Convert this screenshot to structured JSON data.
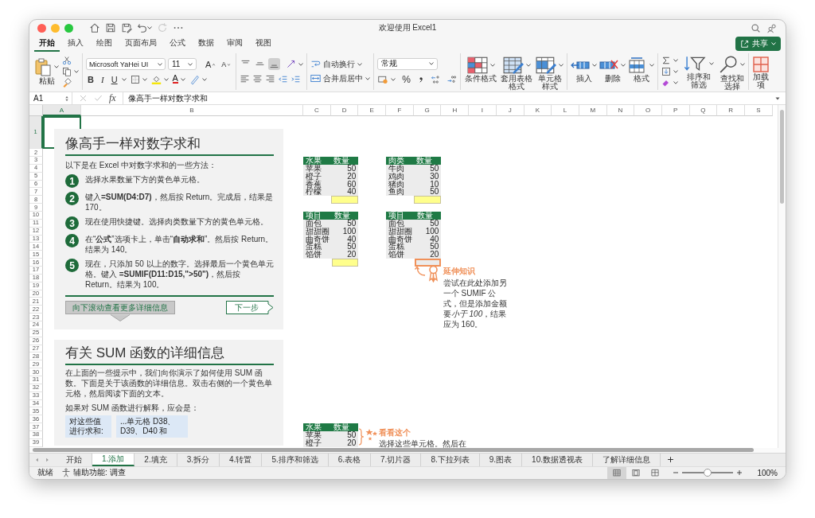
{
  "window": {
    "title": "欢迎使用 Excel1"
  },
  "quick_access": [
    {
      "kind": "home",
      "disabled": false
    },
    {
      "kind": "save",
      "disabled": false
    },
    {
      "kind": "save_as",
      "disabled": false
    },
    {
      "kind": "undo",
      "disabled": false
    },
    {
      "kind": "redo",
      "disabled": true
    },
    {
      "kind": "more",
      "disabled": false
    }
  ],
  "ribbon_tabs": [
    {
      "label": "开始",
      "selected": true
    },
    {
      "label": "插入",
      "selected": false
    },
    {
      "label": "绘图",
      "selected": false
    },
    {
      "label": "页面布局",
      "selected": false
    },
    {
      "label": "公式",
      "selected": false
    },
    {
      "label": "数据",
      "selected": false
    },
    {
      "label": "审阅",
      "selected": false
    },
    {
      "label": "视图",
      "selected": false
    }
  ],
  "share_button": {
    "label": "共享"
  },
  "ribbon": {
    "paste": {
      "label": "粘贴"
    },
    "font": {
      "name": "Microsoft YaHei UI",
      "size": "11",
      "grow": "A",
      "shrink": "A",
      "bold": "B",
      "italic": "I",
      "underline": "U",
      "color_letter": "A"
    },
    "vertical_align": [
      {
        "kind": "top",
        "selected": false
      },
      {
        "kind": "middle",
        "selected": false
      },
      {
        "kind": "bottom",
        "selected": true
      }
    ],
    "wrap_text": "自动换行",
    "merge_center": "合并后居中",
    "number_format": "常规",
    "percent": "%",
    "styles": [
      {
        "kind": "conditional",
        "label": "条件格式"
      },
      {
        "kind": "table",
        "label": "套用表格格式"
      },
      {
        "kind": "cell_styles",
        "label": "单元格样式"
      }
    ],
    "cells": [
      {
        "kind": "insert",
        "label": "插入"
      },
      {
        "kind": "delete",
        "label": "删除"
      },
      {
        "kind": "format",
        "label": "格式"
      }
    ],
    "editing": [
      {
        "kind": "sort",
        "label": "排序和筛选"
      },
      {
        "kind": "find",
        "label": "查找和选择"
      }
    ],
    "addins": {
      "label": "加载项"
    }
  },
  "formula_bar": {
    "name_box": "A1",
    "fx": "fx",
    "value": "像高手一样对数字求和"
  },
  "sheet": {
    "columns": [
      {
        "label": "A",
        "selected": true
      },
      {
        "label": "B",
        "selected": false
      },
      {
        "label": "C",
        "selected": false
      },
      {
        "label": "D",
        "selected": false
      },
      {
        "label": "E",
        "selected": false
      },
      {
        "label": "F",
        "selected": false
      },
      {
        "label": "G",
        "selected": false
      },
      {
        "label": "H",
        "selected": false
      },
      {
        "label": "I",
        "selected": false
      },
      {
        "label": "J",
        "selected": false
      },
      {
        "label": "K",
        "selected": false
      },
      {
        "label": "L",
        "selected": false
      },
      {
        "label": "M",
        "selected": false
      },
      {
        "label": "N",
        "selected": false
      },
      {
        "label": "O",
        "selected": false
      },
      {
        "label": "P",
        "selected": false
      },
      {
        "label": "Q",
        "selected": false
      },
      {
        "label": "R",
        "selected": false
      },
      {
        "label": "S",
        "selected": false
      }
    ],
    "rows": [
      {
        "label": "1",
        "selected": true
      },
      {
        "label": "2",
        "selected": false
      },
      {
        "label": "3",
        "selected": false
      },
      {
        "label": "4",
        "selected": false
      },
      {
        "label": "5",
        "selected": false
      },
      {
        "label": "6",
        "selected": false
      },
      {
        "label": "7",
        "selected": false
      },
      {
        "label": "8",
        "selected": false
      },
      {
        "label": "9",
        "selected": false
      },
      {
        "label": "10",
        "selected": false
      },
      {
        "label": "11",
        "selected": false
      },
      {
        "label": "12",
        "selected": false
      },
      {
        "label": "13",
        "selected": false
      },
      {
        "label": "14",
        "selected": false
      },
      {
        "label": "15",
        "selected": false
      },
      {
        "label": "16",
        "selected": false
      },
      {
        "label": "17",
        "selected": false
      },
      {
        "label": "18",
        "selected": false
      },
      {
        "label": "19",
        "selected": false
      },
      {
        "label": "20",
        "selected": false
      },
      {
        "label": "21",
        "selected": false
      },
      {
        "label": "22",
        "selected": false
      },
      {
        "label": "23",
        "selected": false
      },
      {
        "label": "24",
        "selected": false
      },
      {
        "label": "25",
        "selected": false
      },
      {
        "label": "26",
        "selected": false
      },
      {
        "label": "27",
        "selected": false
      },
      {
        "label": "28",
        "selected": false
      },
      {
        "label": "29",
        "selected": false
      },
      {
        "label": "30",
        "selected": false
      },
      {
        "label": "31",
        "selected": false
      },
      {
        "label": "32",
        "selected": false
      },
      {
        "label": "33",
        "selected": false
      },
      {
        "label": "34",
        "selected": false
      },
      {
        "label": "35",
        "selected": false
      },
      {
        "label": "36",
        "selected": false
      },
      {
        "label": "37",
        "selected": false
      },
      {
        "label": "38",
        "selected": false
      },
      {
        "label": "39",
        "selected": false
      }
    ],
    "guide_card": {
      "title": "像高手一样对数字求和",
      "intro": "以下是在 Excel 中对数字求和的一些方法：",
      "steps": [
        {
          "number": "1",
          "text": "选择水果数量下方的黄色单元格。"
        },
        {
          "number": "2",
          "text": "键入**=SUM(D4:D7)**，然后按 Return。完成后，结果是 170。"
        },
        {
          "number": "3",
          "text": "现在使用快捷键。选择肉类数量下方的黄色单元格。"
        },
        {
          "number": "4",
          "text": "在“**公式**”选项卡上，单击“**自动求和**”。然后按 Return。结果为 140。"
        },
        {
          "number": "5",
          "text": "现在，只添加 50 以上的数字。选择最后一个黄色单元格。键入 **=SUMIF(D11:D15,\">50\")**，然后按 Return。结果为 100。"
        }
      ],
      "scroll_button": "向下滚动查看更多详细信息",
      "next_button": "下一步"
    },
    "details_card": {
      "title": "有关 SUM 函数的详细信息",
      "paragraph": "在上面的一些提示中，我们向你演示了如何使用 SUM 函数。下面是关于该函数的详细信息。双击右侧的一个黄色单元格，然后阅读下面的文本。",
      "explain": "如果对 SUM 函数进行解释，应会是：",
      "boxes": [
        "对这些值进行求和:",
        "...单元格 D38、D39、D40 和"
      ]
    },
    "tables": [
      {
        "columns": [
          "水果",
          "数量"
        ],
        "rows": [
          [
            "苹果",
            "50"
          ],
          [
            "橙子",
            "20"
          ],
          [
            "香蕉",
            "60"
          ],
          [
            "柠檬",
            "40"
          ]
        ],
        "total": {
          "kind": "yellow"
        }
      },
      {
        "columns": [
          "肉类",
          "数量"
        ],
        "rows": [
          [
            "牛肉",
            "50"
          ],
          [
            "鸡肉",
            "30"
          ],
          [
            "猪肉",
            "10"
          ],
          [
            "鱼肉",
            "50"
          ]
        ],
        "total": {
          "kind": "yellow"
        }
      },
      {
        "columns": [
          "项目",
          "数量"
        ],
        "rows": [
          [
            "面包",
            "50"
          ],
          [
            "甜甜圈",
            "100"
          ],
          [
            "曲奇饼",
            "40"
          ],
          [
            "蛋糕",
            "50"
          ],
          [
            "馅饼",
            "20"
          ]
        ],
        "total": {
          "kind": "yellow"
        }
      },
      {
        "columns": [
          "项目",
          "数量"
        ],
        "rows": [
          [
            "面包",
            "50"
          ],
          [
            "甜甜圈",
            "100"
          ],
          [
            "曲奇饼",
            "40"
          ],
          [
            "蛋糕",
            "50"
          ],
          [
            "馅饼",
            "20"
          ]
        ],
        "total": {
          "kind": "outlined"
        }
      },
      {
        "columns": [
          "水果",
          "数量"
        ],
        "rows": [
          [
            "苹果",
            "50"
          ],
          [
            "橙子",
            "20"
          ]
        ]
      }
    ],
    "callout": {
      "title": "延伸知识",
      "text_parts": [
        {
          "text": "尝试在此处添加另一个 SUMIF 公式，但是添加金额要",
          "italic": false
        },
        {
          "text": "小于 100",
          "italic": true
        },
        {
          "text": "，结果应为 160。",
          "italic": false
        }
      ]
    },
    "note": {
      "title": "看看这个",
      "text": "选择这些单元格。然后在"
    }
  },
  "sheet_tabs": [
    {
      "label": "开始",
      "selected": false
    },
    {
      "label": "1.添加",
      "selected": true
    },
    {
      "label": "2.填充",
      "selected": false
    },
    {
      "label": "3.拆分",
      "selected": false
    },
    {
      "label": "4.转置",
      "selected": false
    },
    {
      "label": "5.排序和筛选",
      "selected": false
    },
    {
      "label": "6.表格",
      "selected": false
    },
    {
      "label": "7.切片器",
      "selected": false
    },
    {
      "label": "8.下拉列表",
      "selected": false
    },
    {
      "label": "9.图表",
      "selected": false
    },
    {
      "label": "10.数据透视表",
      "selected": false
    },
    {
      "label": "了解详细信息",
      "selected": false
    }
  ],
  "status_bar": {
    "ready": "就绪",
    "accessibility": "辅助功能: 调查",
    "views": [
      {
        "kind": "normal",
        "selected": true
      },
      {
        "kind": "page_layout",
        "selected": false
      },
      {
        "kind": "page_break",
        "selected": false
      }
    ],
    "zoom": {
      "level": 0.5,
      "label": "100%"
    }
  }
}
